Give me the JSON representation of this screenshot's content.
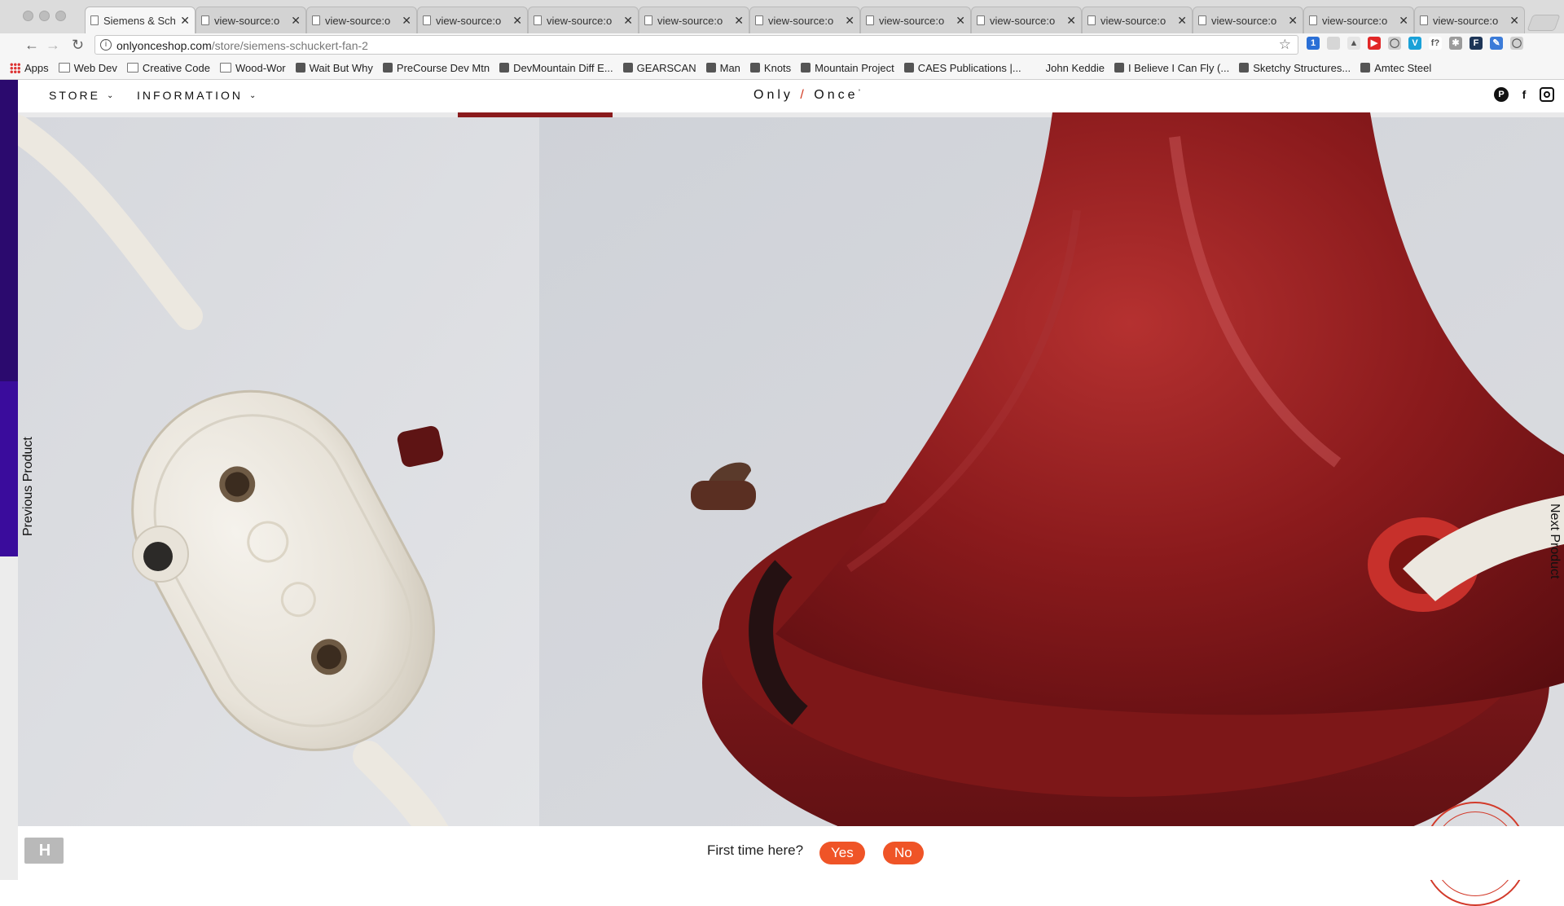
{
  "browser": {
    "tabs": [
      {
        "title": "Siemens & Schuckert",
        "active": true
      },
      {
        "title": "view-source:o",
        "active": false
      },
      {
        "title": "view-source:o",
        "active": false
      },
      {
        "title": "view-source:o",
        "active": false
      },
      {
        "title": "view-source:o",
        "active": false
      },
      {
        "title": "view-source:o",
        "active": false
      },
      {
        "title": "view-source:o",
        "active": false
      },
      {
        "title": "view-source:o",
        "active": false
      },
      {
        "title": "view-source:o",
        "active": false
      },
      {
        "title": "view-source:o",
        "active": false
      },
      {
        "title": "view-source:o",
        "active": false
      },
      {
        "title": "view-source:o",
        "active": false
      },
      {
        "title": "view-source:o",
        "active": false
      }
    ],
    "tab_close": "✕",
    "url_host": "onlyonceshop.com",
    "url_path": "/store/siemens-schuckert-fan-2",
    "bookmarks": [
      {
        "label": "Apps",
        "icon": "apps-grid-icon"
      },
      {
        "label": "Web Dev",
        "icon": "folder-icon"
      },
      {
        "label": "Creative Code",
        "icon": "folder-icon"
      },
      {
        "label": "Wood-Wor",
        "icon": "folder-icon"
      },
      {
        "label": "Wait But Why",
        "icon": "site-icon"
      },
      {
        "label": "PreCourse Dev Mtn",
        "icon": "site-icon"
      },
      {
        "label": "DevMountain Diff E...",
        "icon": "site-icon"
      },
      {
        "label": "GEARSCAN",
        "icon": "site-icon"
      },
      {
        "label": "Man",
        "icon": "site-icon"
      },
      {
        "label": "Knots",
        "icon": "site-icon"
      },
      {
        "label": "Mountain Project",
        "icon": "site-icon"
      },
      {
        "label": "CAES Publications |...",
        "icon": "site-icon"
      },
      {
        "label": "John Keddie",
        "icon": "none"
      },
      {
        "label": "I Believe I Can Fly (...",
        "icon": "site-icon"
      },
      {
        "label": "Sketchy Structures...",
        "icon": "site-icon"
      },
      {
        "label": "Amtec Steel",
        "icon": "site-icon"
      }
    ],
    "extensions": [
      {
        "name": "extension-1-icon",
        "color": "#2a6fd6",
        "glyph": "1"
      },
      {
        "name": "extension-2-icon",
        "color": "#d6d6d6",
        "glyph": ""
      },
      {
        "name": "extension-3-icon",
        "color": "#e5e5e5",
        "glyph": "▲"
      },
      {
        "name": "youtube-icon",
        "color": "#e12727",
        "glyph": "▶"
      },
      {
        "name": "extension-5-icon",
        "color": "#cfcfcf",
        "glyph": "◯"
      },
      {
        "name": "vimeo-icon",
        "color": "#1aa1d8",
        "glyph": "V"
      },
      {
        "name": "formula-icon",
        "color": "#ffffff",
        "glyph": "f?"
      },
      {
        "name": "bug-icon",
        "color": "#9b9b9b",
        "glyph": "✱"
      },
      {
        "name": "extension-9-icon",
        "color": "#1d3557",
        "glyph": "F"
      },
      {
        "name": "eyedropper-icon",
        "color": "#3b7bd8",
        "glyph": "✎"
      },
      {
        "name": "extension-11-icon",
        "color": "#d0d0d0",
        "glyph": "◯"
      }
    ]
  },
  "site": {
    "nav": [
      {
        "label": "STORE"
      },
      {
        "label": "INFORMATION"
      }
    ],
    "chevron": "⌄",
    "logo": {
      "part1": "Only",
      "slash": "/",
      "part2": "Once",
      "mark": "°"
    },
    "social": [
      {
        "name": "pinterest-icon",
        "glyph": "P"
      },
      {
        "name": "facebook-icon",
        "glyph": "f"
      },
      {
        "name": "instagram-icon",
        "glyph": ""
      }
    ],
    "prev_label": "Previous Product",
    "next_label": "Next Product",
    "prompt": {
      "question": "First time here?",
      "yes": "Yes",
      "no": "No"
    },
    "accent_color": "#ef5427",
    "stamp_color": "#d23a2a",
    "corner_logo": "H"
  }
}
